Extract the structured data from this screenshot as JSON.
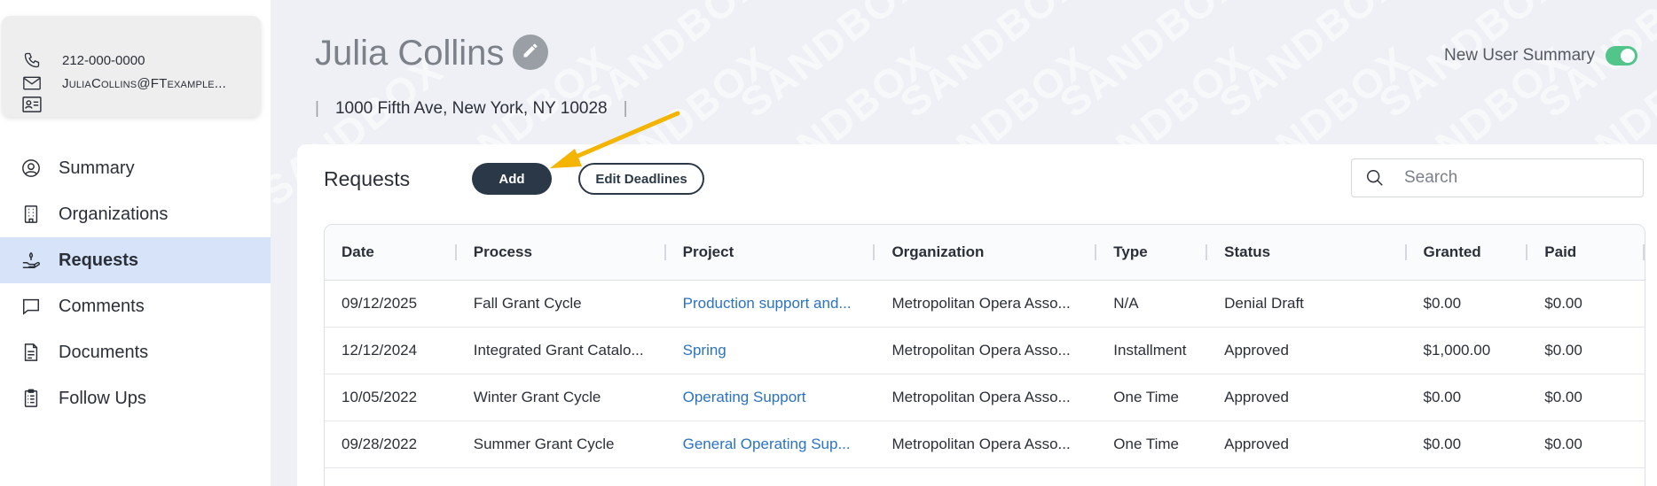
{
  "contact": {
    "phone": "212-000-0000",
    "email": "JuliaCollins@FTexample..."
  },
  "nav": {
    "items": [
      {
        "label": "Summary",
        "icon": "user-circle-icon"
      },
      {
        "label": "Organizations",
        "icon": "building-icon"
      },
      {
        "label": "Requests",
        "icon": "hand-request-icon"
      },
      {
        "label": "Comments",
        "icon": "comment-icon"
      },
      {
        "label": "Documents",
        "icon": "document-icon"
      },
      {
        "label": "Follow Ups",
        "icon": "clipboard-icon"
      }
    ],
    "active": "Requests"
  },
  "header": {
    "name": "Julia Collins",
    "address": "1000 Fifth Ave, New York, NY 10028",
    "summary_toggle_label": "New User Summary",
    "summary_toggle_on": true
  },
  "watermark": "SANDBOX",
  "requests": {
    "title": "Requests",
    "add_label": "Add",
    "edit_deadlines_label": "Edit Deadlines",
    "search_placeholder": "Search",
    "columns": [
      "Date",
      "Process",
      "Project",
      "Organization",
      "Type",
      "Status",
      "Granted",
      "Paid"
    ],
    "rows": [
      {
        "date": "09/12/2025",
        "process": "Fall Grant Cycle",
        "project": "Production support and...",
        "organization": "Metropolitan Opera Asso...",
        "type": "N/A",
        "status": "Denial Draft",
        "granted": "$0.00",
        "paid": "$0.00"
      },
      {
        "date": "12/12/2024",
        "process": "Integrated Grant Catalo...",
        "project": "Spring",
        "organization": "Metropolitan Opera Asso...",
        "type": "Installment",
        "status": "Approved",
        "granted": "$1,000.00",
        "paid": "$0.00"
      },
      {
        "date": "10/05/2022",
        "process": "Winter Grant Cycle",
        "project": "Operating Support",
        "organization": "Metropolitan Opera Asso...",
        "type": "One Time",
        "status": "Approved",
        "granted": "$0.00",
        "paid": "$0.00"
      },
      {
        "date": "09/28/2022",
        "process": "Summer Grant Cycle",
        "project": "General Operating Sup...",
        "organization": "Metropolitan Opera Asso...",
        "type": "One Time",
        "status": "Approved",
        "granted": "$0.00",
        "paid": "$0.00"
      }
    ]
  },
  "colors": {
    "accent_dark": "#2b3847",
    "link": "#2b72c2",
    "active_nav_bg": "#d7e3f9",
    "toggle_on": "#52c58a",
    "arrow": "#f4b400"
  }
}
